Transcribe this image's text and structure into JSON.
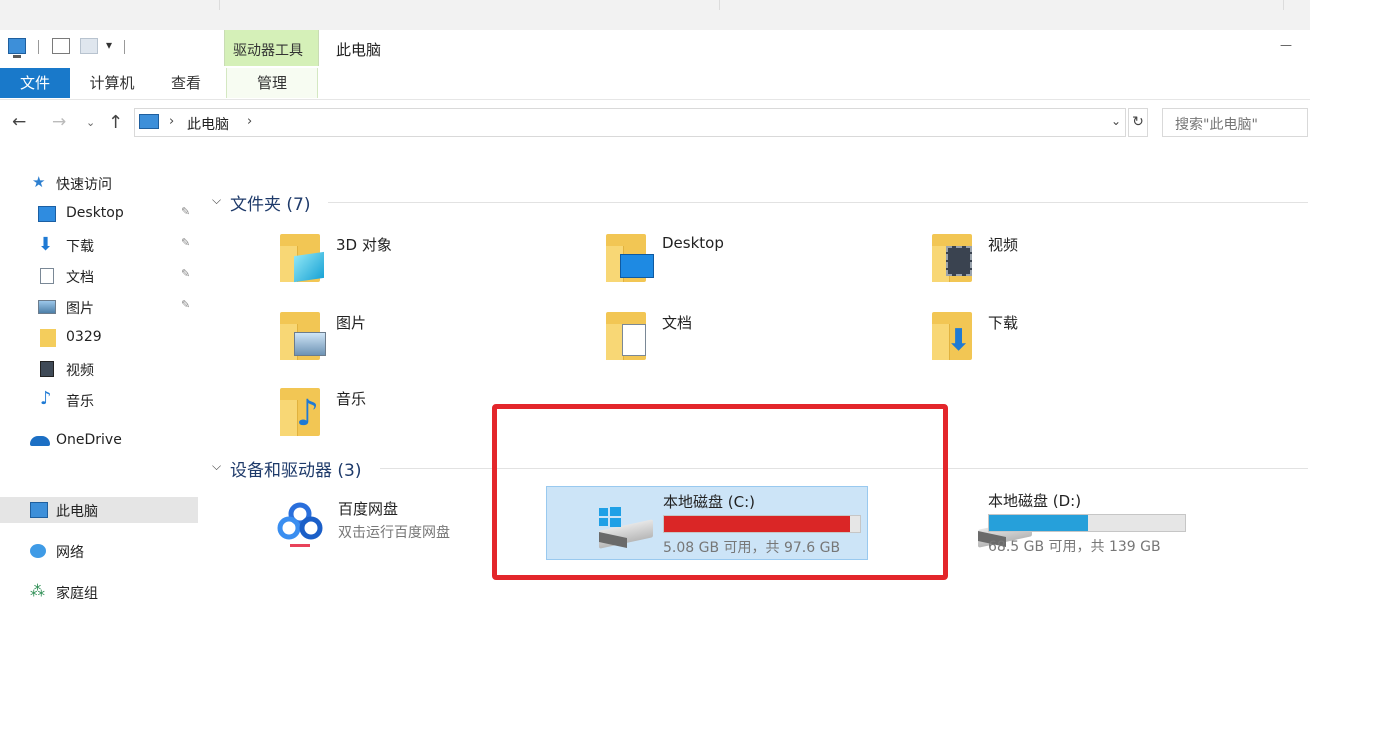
{
  "quick_access_toolbar": {
    "dropdown_glyph": "▾"
  },
  "contextual_tab_header": "驱动器工具",
  "window": {
    "title": "此电脑",
    "minimize_glyph": "—"
  },
  "ribbon": {
    "tabs": [
      "文件",
      "计算机",
      "查看",
      "管理"
    ]
  },
  "address": {
    "back_glyph": "←",
    "forward_glyph": "→",
    "recent_glyph": "⌄",
    "up_glyph": "↑",
    "separator": "›",
    "crumb": "此电脑",
    "dropdown_glyph": "⌄",
    "refresh_glyph": "↻",
    "search_placeholder": "搜索\"此电脑\""
  },
  "nav_pane": {
    "quick_access": "快速访问",
    "pin_glyph": "📌",
    "items": [
      {
        "label": "Desktop",
        "icon": "desktop-icon"
      },
      {
        "label": "下载",
        "icon": "download-icon"
      },
      {
        "label": "文档",
        "icon": "document-icon"
      },
      {
        "label": "图片",
        "icon": "picture-icon"
      },
      {
        "label": "0329",
        "icon": "folder-icon"
      },
      {
        "label": "视频",
        "icon": "video-icon"
      },
      {
        "label": "音乐",
        "icon": "music-icon"
      }
    ],
    "onedrive": "OneDrive",
    "this_pc": "此电脑",
    "network": "网络",
    "homegroup": "家庭组"
  },
  "groups": {
    "folders_header": "文件夹 (7)",
    "devices_header": "设备和驱动器 (3)",
    "chevron": "⌵"
  },
  "folders": [
    "3D 对象",
    "Desktop",
    "视频",
    "图片",
    "文档",
    "下载",
    "音乐"
  ],
  "devices": {
    "baidu": {
      "name": "百度网盘",
      "subtitle": "双击运行百度网盘"
    },
    "c": {
      "name": "本地磁盘 (C:)",
      "free_text": "5.08 GB 可用，共 97.6 GB",
      "used_fraction": 0.948,
      "bar_color": "#da2626"
    },
    "d": {
      "name": "本地磁盘 (D:)",
      "free_text": "68.5 GB 可用，共 139 GB",
      "used_fraction": 0.507,
      "bar_color": "#26a0da"
    }
  }
}
